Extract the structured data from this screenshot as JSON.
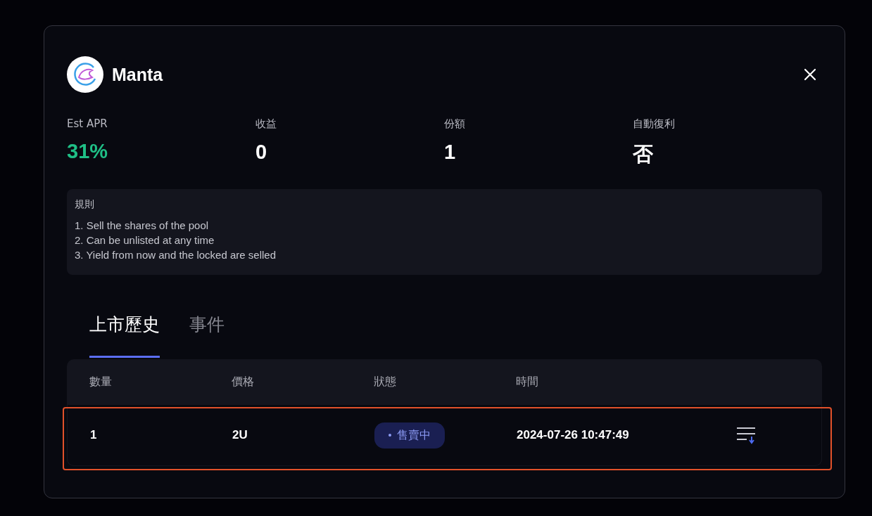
{
  "modal": {
    "title": "Manta",
    "stats": [
      {
        "label": "Est APR",
        "value": "31%",
        "kind": "positive"
      },
      {
        "label": "收益",
        "value": "0",
        "kind": "plain"
      },
      {
        "label": "份額",
        "value": "1",
        "kind": "plain"
      },
      {
        "label": "自動復利",
        "value": "否",
        "kind": "plain"
      }
    ],
    "rules": {
      "title": "規則",
      "lines": [
        "1. Sell the shares of the pool",
        "2. Can be unlisted at any time",
        "3. Yield from now and the locked are selled"
      ]
    },
    "tabs": [
      {
        "label": "上市歷史",
        "selected": true
      },
      {
        "label": "事件",
        "selected": false
      }
    ],
    "table": {
      "columns": [
        "數量",
        "價格",
        "狀態",
        "時間"
      ],
      "rows": [
        {
          "cells": [
            "1",
            "2U"
          ],
          "status": "售賣中",
          "time": "2024-07-26 10:47:49",
          "highlighted": true
        }
      ]
    }
  }
}
